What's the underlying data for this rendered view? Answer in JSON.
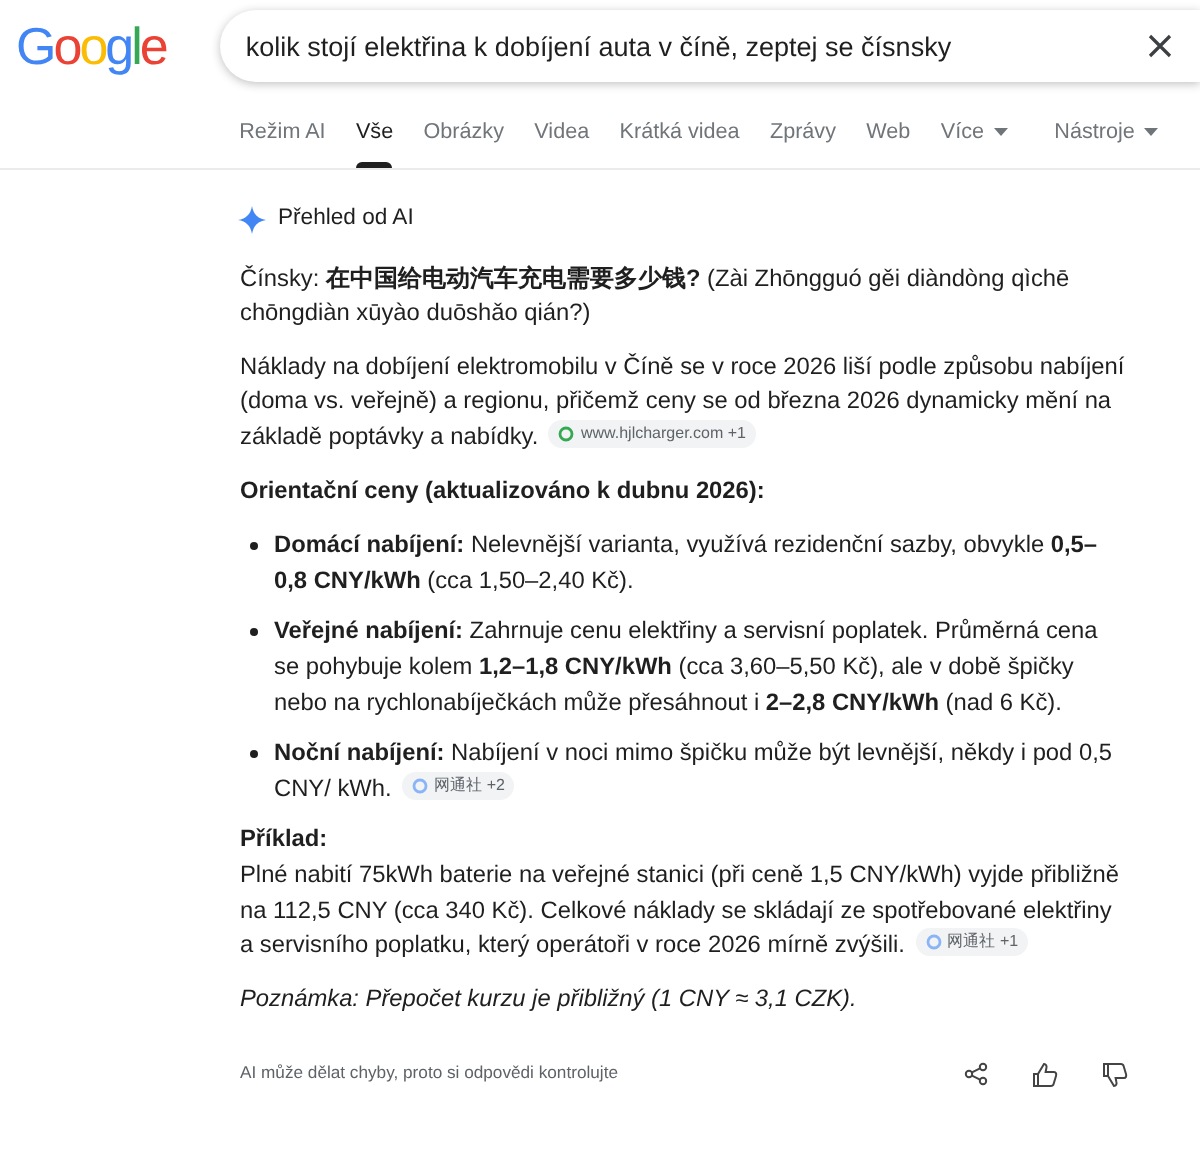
{
  "header": {
    "logo": "Google",
    "query": "kolik stojí elektřina k dobíjení auta v číně, zeptej se čísnsky"
  },
  "tabs": [
    {
      "label": "Režim AI",
      "selected": false,
      "dropdown": false
    },
    {
      "label": "Vše",
      "selected": true,
      "dropdown": false
    },
    {
      "label": "Obrázky",
      "selected": false,
      "dropdown": false
    },
    {
      "label": "Videa",
      "selected": false,
      "dropdown": false
    },
    {
      "label": "Krátká videa",
      "selected": false,
      "dropdown": false
    },
    {
      "label": "Zprávy",
      "selected": false,
      "dropdown": false
    },
    {
      "label": "Web",
      "selected": false,
      "dropdown": false
    },
    {
      "label": "Více",
      "selected": false,
      "dropdown": true
    },
    {
      "label": "Nástroje",
      "selected": false,
      "dropdown": true
    }
  ],
  "overview": {
    "title": "Přehled od AI",
    "blocks": [
      {
        "kind": "paragraph",
        "text": "Čínsky: **在中国给电动汽车充电需要多少钱?**  (Zài Zhōngguó gěi diàndòng qìchē chōngdiàn xūyào duōshǎo qián?)"
      },
      {
        "kind": "paragraph",
        "text": "Náklady na dobíjení elektromobilu v Číně se v roce 2026 liší podle způsobu nabíjení (doma vs. veřejně) a regionu, přičemž ceny se od března 2026 dynamicky mění na základě poptávky a nabídky.",
        "citation": {
          "source": "www.hjlcharger.com",
          "count": "+1",
          "color": "#34a853"
        }
      },
      {
        "kind": "heading",
        "text": "Orientační ceny (aktualizováno k dubnu 2026):"
      },
      {
        "kind": "list",
        "items": [
          {
            "text": "**Domácí nabíjení:** Nelevnější varianta, využívá rezidenční sazby, obvykle **0,5–0,8 CNY/kWh** (cca 1,50–2,40 Kč)."
          },
          {
            "text": "**Veřejné nabíjení:** Zahrnuje cenu elektřiny a servisní poplatek. Průměrná cena se pohybuje kolem **1,2–1,8 CNY/kWh** (cca 3,60–5,50 Kč), ale v době špičky nebo na rychlonabíječkách může přesáhnout i **2–2,8 CNY/kWh** (nad 6 Kč)."
          },
          {
            "text": "**Noční nabíjení:** Nabíjení v noci mimo špičku může být levnější, někdy i pod 0,5 CNY/ kWh.",
            "citation": {
              "source": "网通社",
              "count": "+2",
              "color": "#8ab4f8"
            }
          }
        ]
      },
      {
        "kind": "example",
        "title": "Příklad:",
        "text": "Plné nabití 75kWh baterie na veřejné stanici (při ceně 1,5 CNY/kWh) vyjde přibližně na 112,5 CNY (cca 340 Kč). Celkové náklady se skládají ze spotřebované elektřiny a servisního poplatku, který operátoři v roce 2026 mírně zvýšili.",
        "citation": {
          "source": "网通社",
          "count": "+1",
          "color": "#8ab4f8"
        }
      },
      {
        "kind": "note",
        "text": "Poznámka: Přepočet kurzu je přibližný (1 CNY ≈ 3,1 CZK)."
      }
    ],
    "disclaimer": "AI může dělat chyby, proto si odpovědi kontrolujte"
  }
}
